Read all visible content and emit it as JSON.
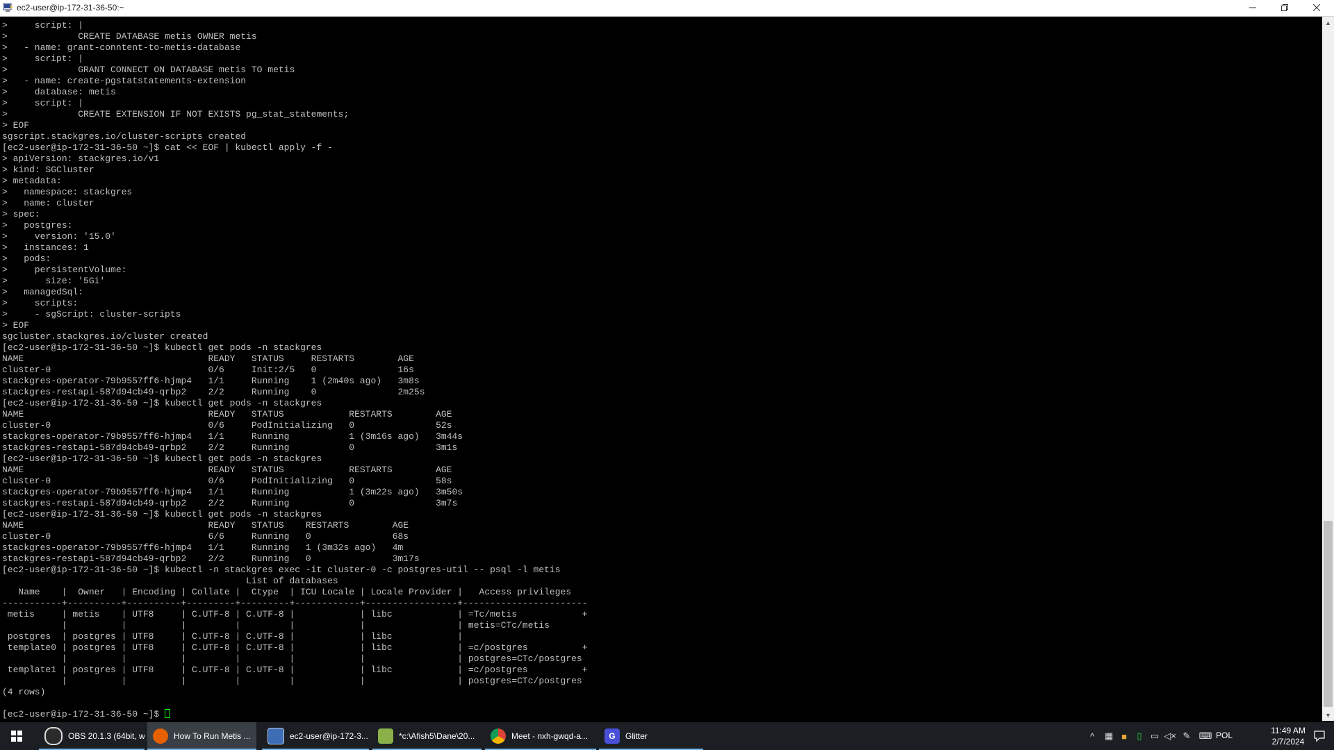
{
  "window": {
    "title": "ec2-user@ip-172-31-36-50:~",
    "minimize_icon": "minimize-icon",
    "maximize_icon": "restore-icon",
    "close_icon": "close-icon"
  },
  "terminal": {
    "lines": [
      ">     script: |",
      ">             CREATE DATABASE metis OWNER metis",
      ">   - name: grant-conntent-to-metis-database",
      ">     script: |",
      ">             GRANT CONNECT ON DATABASE metis TO metis",
      ">   - name: create-pgstatstatements-extension",
      ">     database: metis",
      ">     script: |",
      ">             CREATE EXTENSION IF NOT EXISTS pg_stat_statements;",
      "> EOF",
      "sgscript.stackgres.io/cluster-scripts created",
      "[ec2-user@ip-172-31-36-50 ~]$ cat << EOF | kubectl apply -f -",
      "> apiVersion: stackgres.io/v1",
      "> kind: SGCluster",
      "> metadata:",
      ">   namespace: stackgres",
      ">   name: cluster",
      "> spec:",
      ">   postgres:",
      ">     version: '15.0'",
      ">   instances: 1",
      ">   pods:",
      ">     persistentVolume:",
      ">       size: '5Gi'",
      ">   managedSql:",
      ">     scripts:",
      ">     - sgScript: cluster-scripts",
      "> EOF",
      "sgcluster.stackgres.io/cluster created",
      "[ec2-user@ip-172-31-36-50 ~]$ kubectl get pods -n stackgres",
      "NAME                                  READY   STATUS     RESTARTS        AGE",
      "cluster-0                             0/6     Init:2/5   0               16s",
      "stackgres-operator-79b9557ff6-hjmp4   1/1     Running    1 (2m40s ago)   3m8s",
      "stackgres-restapi-587d94cb49-qrbp2    2/2     Running    0               2m25s",
      "[ec2-user@ip-172-31-36-50 ~]$ kubectl get pods -n stackgres",
      "NAME                                  READY   STATUS            RESTARTS        AGE",
      "cluster-0                             0/6     PodInitializing   0               52s",
      "stackgres-operator-79b9557ff6-hjmp4   1/1     Running           1 (3m16s ago)   3m44s",
      "stackgres-restapi-587d94cb49-qrbp2    2/2     Running           0               3m1s",
      "[ec2-user@ip-172-31-36-50 ~]$ kubectl get pods -n stackgres",
      "NAME                                  READY   STATUS            RESTARTS        AGE",
      "cluster-0                             0/6     PodInitializing   0               58s",
      "stackgres-operator-79b9557ff6-hjmp4   1/1     Running           1 (3m22s ago)   3m50s",
      "stackgres-restapi-587d94cb49-qrbp2    2/2     Running           0               3m7s",
      "[ec2-user@ip-172-31-36-50 ~]$ kubectl get pods -n stackgres",
      "NAME                                  READY   STATUS    RESTARTS        AGE",
      "cluster-0                             6/6     Running   0               68s",
      "stackgres-operator-79b9557ff6-hjmp4   1/1     Running   1 (3m32s ago)   4m",
      "stackgres-restapi-587d94cb49-qrbp2    2/2     Running   0               3m17s",
      "[ec2-user@ip-172-31-36-50 ~]$ kubectl -n stackgres exec -it cluster-0 -c postgres-util -- psql -l metis",
      "                                             List of databases",
      "   Name    |  Owner   | Encoding | Collate |  Ctype  | ICU Locale | Locale Provider |   Access privileges",
      "-----------+----------+----------+---------+---------+------------+-----------------+-----------------------",
      " metis     | metis    | UTF8     | C.UTF-8 | C.UTF-8 |            | libc            | =Tc/metis            +",
      "           |          |          |         |         |            |                 | metis=CTc/metis",
      " postgres  | postgres | UTF8     | C.UTF-8 | C.UTF-8 |            | libc            |",
      " template0 | postgres | UTF8     | C.UTF-8 | C.UTF-8 |            | libc            | =c/postgres          +",
      "           |          |          |         |         |            |                 | postgres=CTc/postgres",
      " template1 | postgres | UTF8     | C.UTF-8 | C.UTF-8 |            | libc            | =c/postgres          +",
      "           |          |          |         |         |            |                 | postgres=CTc/postgres",
      "(4 rows)",
      ""
    ],
    "prompt": "[ec2-user@ip-172-31-36-50 ~]$ "
  },
  "taskbar": {
    "start_icon": "windows-start-icon",
    "items": [
      {
        "label": "OBS 20.1.3 (64bit, w...",
        "icon": "obs-icon",
        "color": "#2b2b2b"
      },
      {
        "label": "How To Run Metis ...",
        "icon": "firefox-icon",
        "color": "#e66000"
      },
      {
        "label": "ec2-user@ip-172-3...",
        "icon": "putty-icon",
        "color": "#3d6db5"
      },
      {
        "label": "*c:\\Afish5\\Dane\\20...",
        "icon": "notepad-plus-icon",
        "color": "#8ab04a"
      },
      {
        "label": "Meet - nxh-gwqd-a...",
        "icon": "chrome-icon",
        "color": "#db4437"
      },
      {
        "label": "Glitter",
        "icon": "glitter-icon",
        "color": "#4a4fd8"
      }
    ],
    "tray": {
      "language": "POL",
      "time": "11:49 AM",
      "date": "2/7/2024"
    }
  },
  "colors": {
    "terminal_bg": "#000000",
    "terminal_fg": "#c0c0c0",
    "cursor": "#00ff00",
    "taskbar_bg": "#1b1f23",
    "taskbar_accent": "#76b9ed"
  }
}
